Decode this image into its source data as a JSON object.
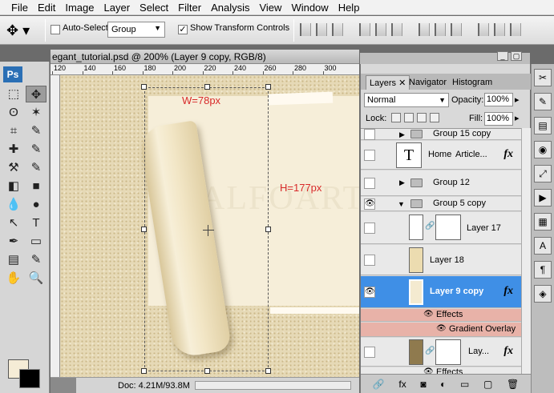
{
  "menu": [
    "File",
    "Edit",
    "Image",
    "Layer",
    "Select",
    "Filter",
    "Analysis",
    "View",
    "Window",
    "Help"
  ],
  "options": {
    "auto_select_label": "Auto-Select:",
    "auto_select_checked": false,
    "auto_select_value": "Group",
    "show_transform_label": "Show Transform Controls",
    "show_transform_checked": true
  },
  "tools": {
    "logo": "Ps",
    "icons": [
      "marquee-icon",
      "move-icon",
      "lasso-icon",
      "magic-wand-icon",
      "crop-icon",
      "slice-icon",
      "healing-icon",
      "brush-icon",
      "stamp-icon",
      "history-brush-icon",
      "eraser-icon",
      "gradient-icon",
      "blur-icon",
      "dodge-icon",
      "path-select-icon",
      "type-icon",
      "pen-icon",
      "shape-icon",
      "notes-icon",
      "eyedropper-icon",
      "hand-icon",
      "zoom-icon"
    ],
    "glyphs": [
      "⬚",
      "✥",
      "ʘ",
      "✶",
      "⌗",
      "✎",
      "✚",
      "✎",
      "⚒",
      "✎",
      "◧",
      "■",
      "💧",
      "●",
      "↖",
      "T",
      "✒",
      "▭",
      "▤",
      "✎",
      "✋",
      "🔍"
    ],
    "fg_color": "#f5ecd6",
    "bg_color": "#000000"
  },
  "document": {
    "title": "egant_tutorial.psd @ 200% (Layer 9 copy, RGB/8)",
    "ruler_labels": [
      "120",
      "140",
      "160",
      "180",
      "200",
      "220",
      "240",
      "260",
      "280",
      "300"
    ],
    "width_label": "W=78px",
    "height_label": "H=177px",
    "watermark": "ALFOART",
    "status": "Doc: 4.21M/93.8M",
    "zoom": "200%"
  },
  "layers_panel": {
    "tabs": [
      "Layers",
      "Navigator",
      "Histogram"
    ],
    "blend_mode": "Normal",
    "opacity_label": "Opacity:",
    "opacity_value": "100%",
    "lock_label": "Lock:",
    "fill_label": "Fill:",
    "fill_value": "100%",
    "rows": [
      {
        "type": "group",
        "name": "Group 15 copy",
        "visible": false
      },
      {
        "type": "text",
        "name": "Home",
        "extra": "Article...",
        "fx": true,
        "visible": false
      },
      {
        "type": "group",
        "name": "Group 12",
        "visible": false
      },
      {
        "type": "group-open",
        "name": "Group 5 copy",
        "visible": true
      },
      {
        "type": "layer-mask",
        "name": "Layer 17",
        "visible": false
      },
      {
        "type": "layer",
        "name": "Layer 18",
        "visible": false
      },
      {
        "type": "layer-selected",
        "name": "Layer 9 copy",
        "fx": true,
        "visible": true
      },
      {
        "type": "effect",
        "name": "Effects",
        "visible": true
      },
      {
        "type": "effect-sub",
        "name": "Gradient Overlay",
        "visible": true
      },
      {
        "type": "layer-mask",
        "name": "Lay...",
        "fx": true,
        "visible": false
      },
      {
        "type": "effect",
        "name": "Effects",
        "visible": true
      }
    ],
    "bottom_icons": [
      "link-icon",
      "fx-icon",
      "mask-icon",
      "adjustment-icon",
      "folder-icon",
      "new-layer-icon",
      "trash-icon"
    ],
    "bottom_glyphs": [
      "🔗",
      "fx",
      "◙",
      "◐",
      "▭",
      "▢",
      "🗑"
    ]
  }
}
